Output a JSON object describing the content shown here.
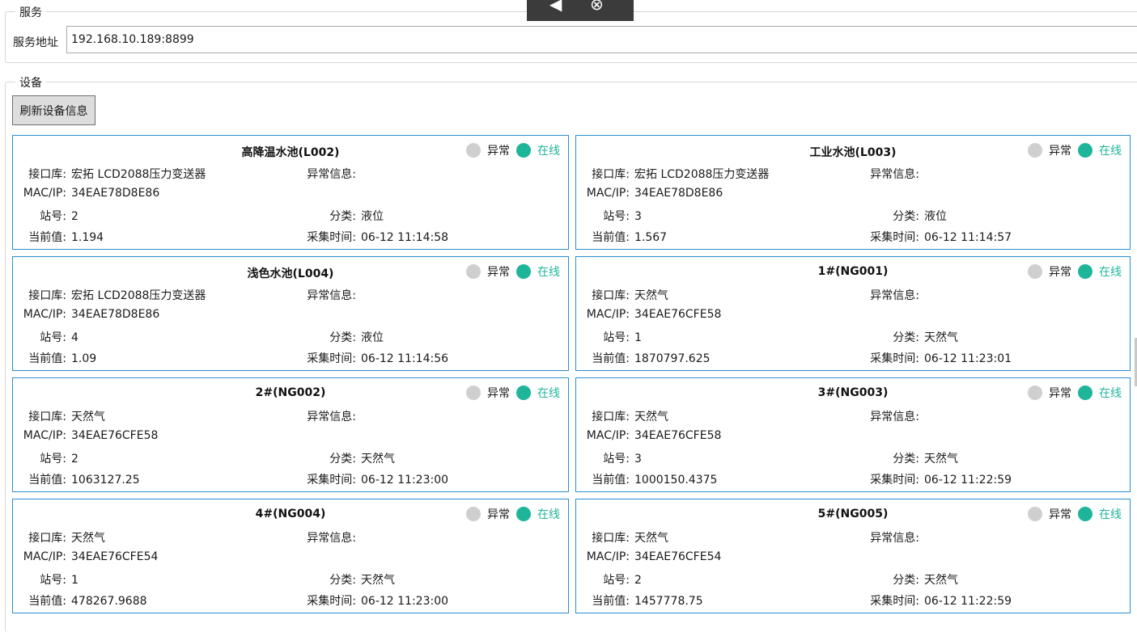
{
  "service": {
    "legend": "服务",
    "address_label": "服务地址",
    "address_value": "192.168.10.189:8899"
  },
  "devices": {
    "legend": "设备",
    "refresh_label": "刷新设备信息",
    "labels": {
      "lib": "接口库:",
      "mac": "MAC/IP:",
      "station": "站号:",
      "current": "当前值:",
      "error": "异常信息:",
      "category": "分类:",
      "time": "采集时间:",
      "abnormal": "异常",
      "online": "在线"
    },
    "items": [
      {
        "title": "高降温水池(L002)",
        "lib": "宏拓 LCD2088压力变送器",
        "mac": "34EAE78D8E86",
        "station": "2",
        "current": "1.194",
        "error": "",
        "category": "液位",
        "time": "06-12 11:14:58"
      },
      {
        "title": "工业水池(L003)",
        "lib": "宏拓 LCD2088压力变送器",
        "mac": "34EAE78D8E86",
        "station": "3",
        "current": "1.567",
        "error": "",
        "category": "液位",
        "time": "06-12 11:14:57"
      },
      {
        "title": "浅色水池(L004)",
        "lib": "宏拓 LCD2088压力变送器",
        "mac": "34EAE78D8E86",
        "station": "4",
        "current": "1.09",
        "error": "",
        "category": "液位",
        "time": "06-12 11:14:56"
      },
      {
        "title": "1#(NG001)",
        "lib": "天然气",
        "mac": "34EAE76CFE58",
        "station": "1",
        "current": "1870797.625",
        "error": "",
        "category": "天然气",
        "time": "06-12 11:23:01"
      },
      {
        "title": "2#(NG002)",
        "lib": "天然气",
        "mac": "34EAE76CFE58",
        "station": "2",
        "current": "1063127.25",
        "error": "",
        "category": "天然气",
        "time": "06-12 11:23:00"
      },
      {
        "title": "3#(NG003)",
        "lib": "天然气",
        "mac": "34EAE76CFE58",
        "station": "3",
        "current": "1000150.4375",
        "error": "",
        "category": "天然气",
        "time": "06-12 11:22:59"
      },
      {
        "title": "4#(NG004)",
        "lib": "天然气",
        "mac": "34EAE76CFE54",
        "station": "1",
        "current": "478267.9688",
        "error": "",
        "category": "天然气",
        "time": "06-12 11:23:00"
      },
      {
        "title": "5#(NG005)",
        "lib": "天然气",
        "mac": "34EAE76CFE54",
        "station": "2",
        "current": "1457778.75",
        "error": "",
        "category": "天然气",
        "time": "06-12 11:22:59"
      }
    ]
  },
  "overlay": {
    "back_icon": "back-arrow-icon",
    "close_icon": "close-circle-icon"
  },
  "colors": {
    "card_border": "#2a8fd0",
    "online": "#1fb59a",
    "abnormal_dot": "#cfcfcf"
  }
}
